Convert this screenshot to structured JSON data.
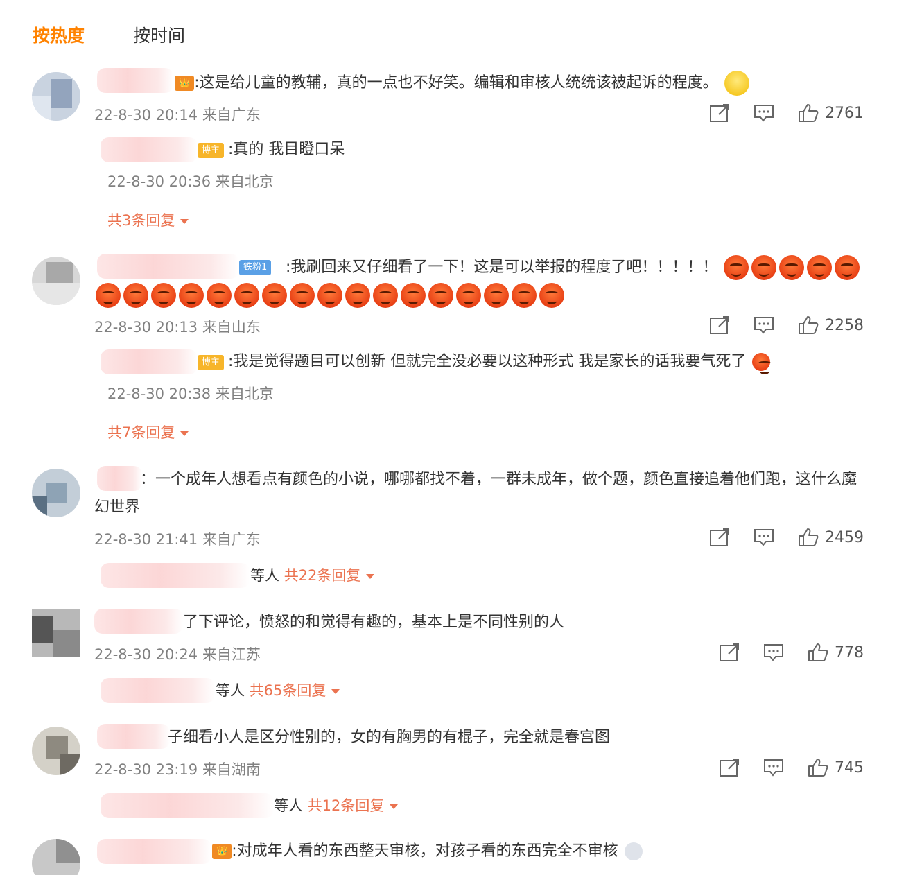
{
  "tabs": {
    "hot": "按热度",
    "time": "按时间"
  },
  "icons": {
    "share": "share-icon",
    "comment": "comment-icon",
    "like": "like-icon"
  },
  "colors": {
    "accent": "#ff8200",
    "reply_link": "#eb7350",
    "meta": "#808080"
  },
  "comments": [
    {
      "text": ":这是给儿童的教辅，真的一点也不好笑。编辑和审核人统统该被起诉的程度。",
      "time": "22-8-30 20:14 来自广东",
      "likes": "2761",
      "reply": {
        "badge": "博主",
        "text": ":真的 我目瞪口呆",
        "time": "22-8-30 20:36 来自北京"
      },
      "more": "共3条回复"
    },
    {
      "badge": "铁粉1",
      "text": ":我刷回来又仔细看了一下！这是可以举报的程度了吧！！！！！",
      "time": "22-8-30 20:13 来自山东",
      "likes": "2258",
      "reply": {
        "badge": "博主",
        "text": ":我是觉得题目可以创新 但就完全没必要以这种形式 我是家长的话我要气死了",
        "time": "22-8-30 20:38 来自北京"
      },
      "more": "共7条回复"
    },
    {
      "text": "：一个成年人想看点有颜色的小说，哪哪都找不着，一群未成年，做个题，颜色直接追着他们跑，这什么魔幻世界",
      "time": "22-8-30 21:41 来自广东",
      "likes": "2459",
      "others": "等人",
      "more": "共22条回复"
    },
    {
      "text": "了下评论，愤怒的和觉得有趣的，基本上是不同性别的人",
      "time": "22-8-30 20:24 来自江苏",
      "likes": "778",
      "others": "等人",
      "more": "共65条回复"
    },
    {
      "text": "子细看小人是区分性别的，女的有胸男的有棍子，完全就是春宫图",
      "time": "22-8-30 23:19 来自湖南",
      "likes": "745",
      "others": "等人",
      "more": "共12条回复"
    },
    {
      "text": ":对成年人看的东西整天审核，对孩子看的东西完全不审核"
    }
  ]
}
